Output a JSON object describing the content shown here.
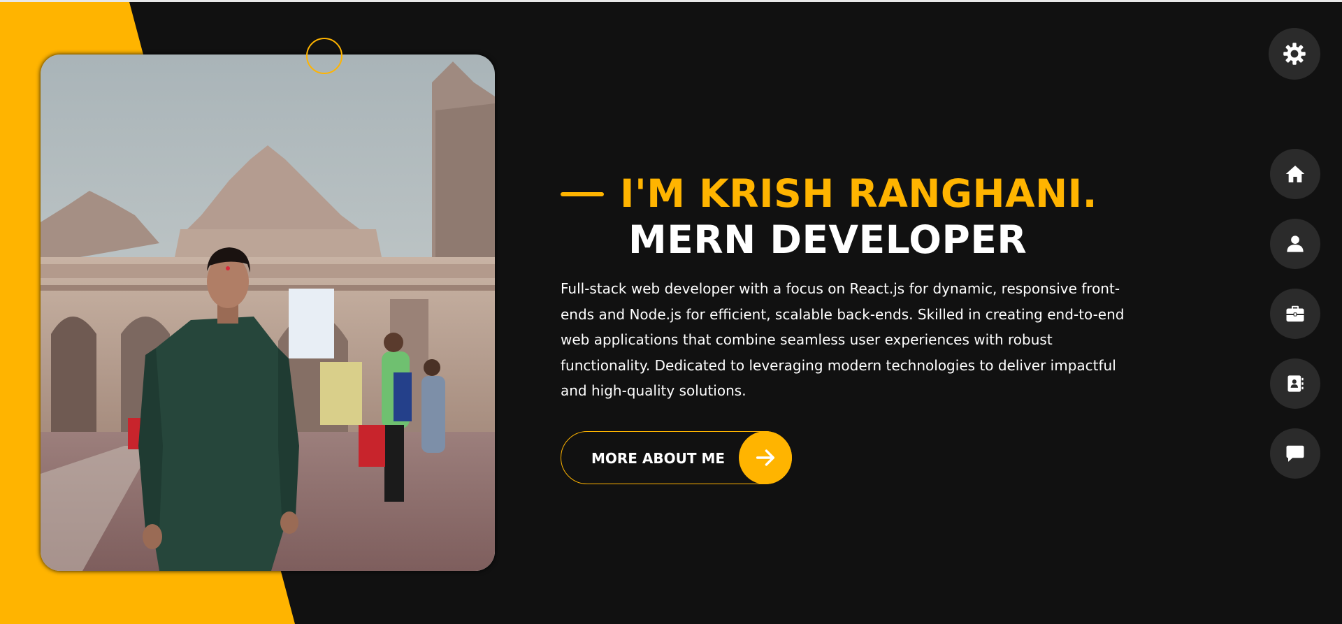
{
  "hero": {
    "title": "I'M KRISH RANGHANI.",
    "subtitle": "MERN DEVELOPER",
    "description": "Full-stack web developer with a focus on React.js for dynamic, responsive front-ends and Node.js for efficient, scalable back-ends. Skilled in creating end-to-end web applications that combine seamless user experiences with robust functionality. Dedicated to leveraging modern technologies to deliver impactful and high-quality solutions.",
    "more_button_label": "MORE ABOUT ME",
    "more_button_icon": "arrow-right-icon"
  },
  "photo": {
    "alt": "Krish Ranghani standing in front of a temple"
  },
  "theme_toggle": {
    "icon": "gear-icon"
  },
  "nav": {
    "items": [
      {
        "id": "home",
        "icon": "home-icon",
        "active": true
      },
      {
        "id": "about",
        "icon": "user-icon",
        "active": false
      },
      {
        "id": "portfolio",
        "icon": "briefcase-icon",
        "active": false
      },
      {
        "id": "contact",
        "icon": "address-book-icon",
        "active": false
      },
      {
        "id": "blog",
        "icon": "comment-icon",
        "active": false
      }
    ]
  },
  "colors": {
    "accent": "#ffb400",
    "background": "#111111",
    "nav_bg": "#2b2b2b",
    "text": "#ffffff"
  }
}
